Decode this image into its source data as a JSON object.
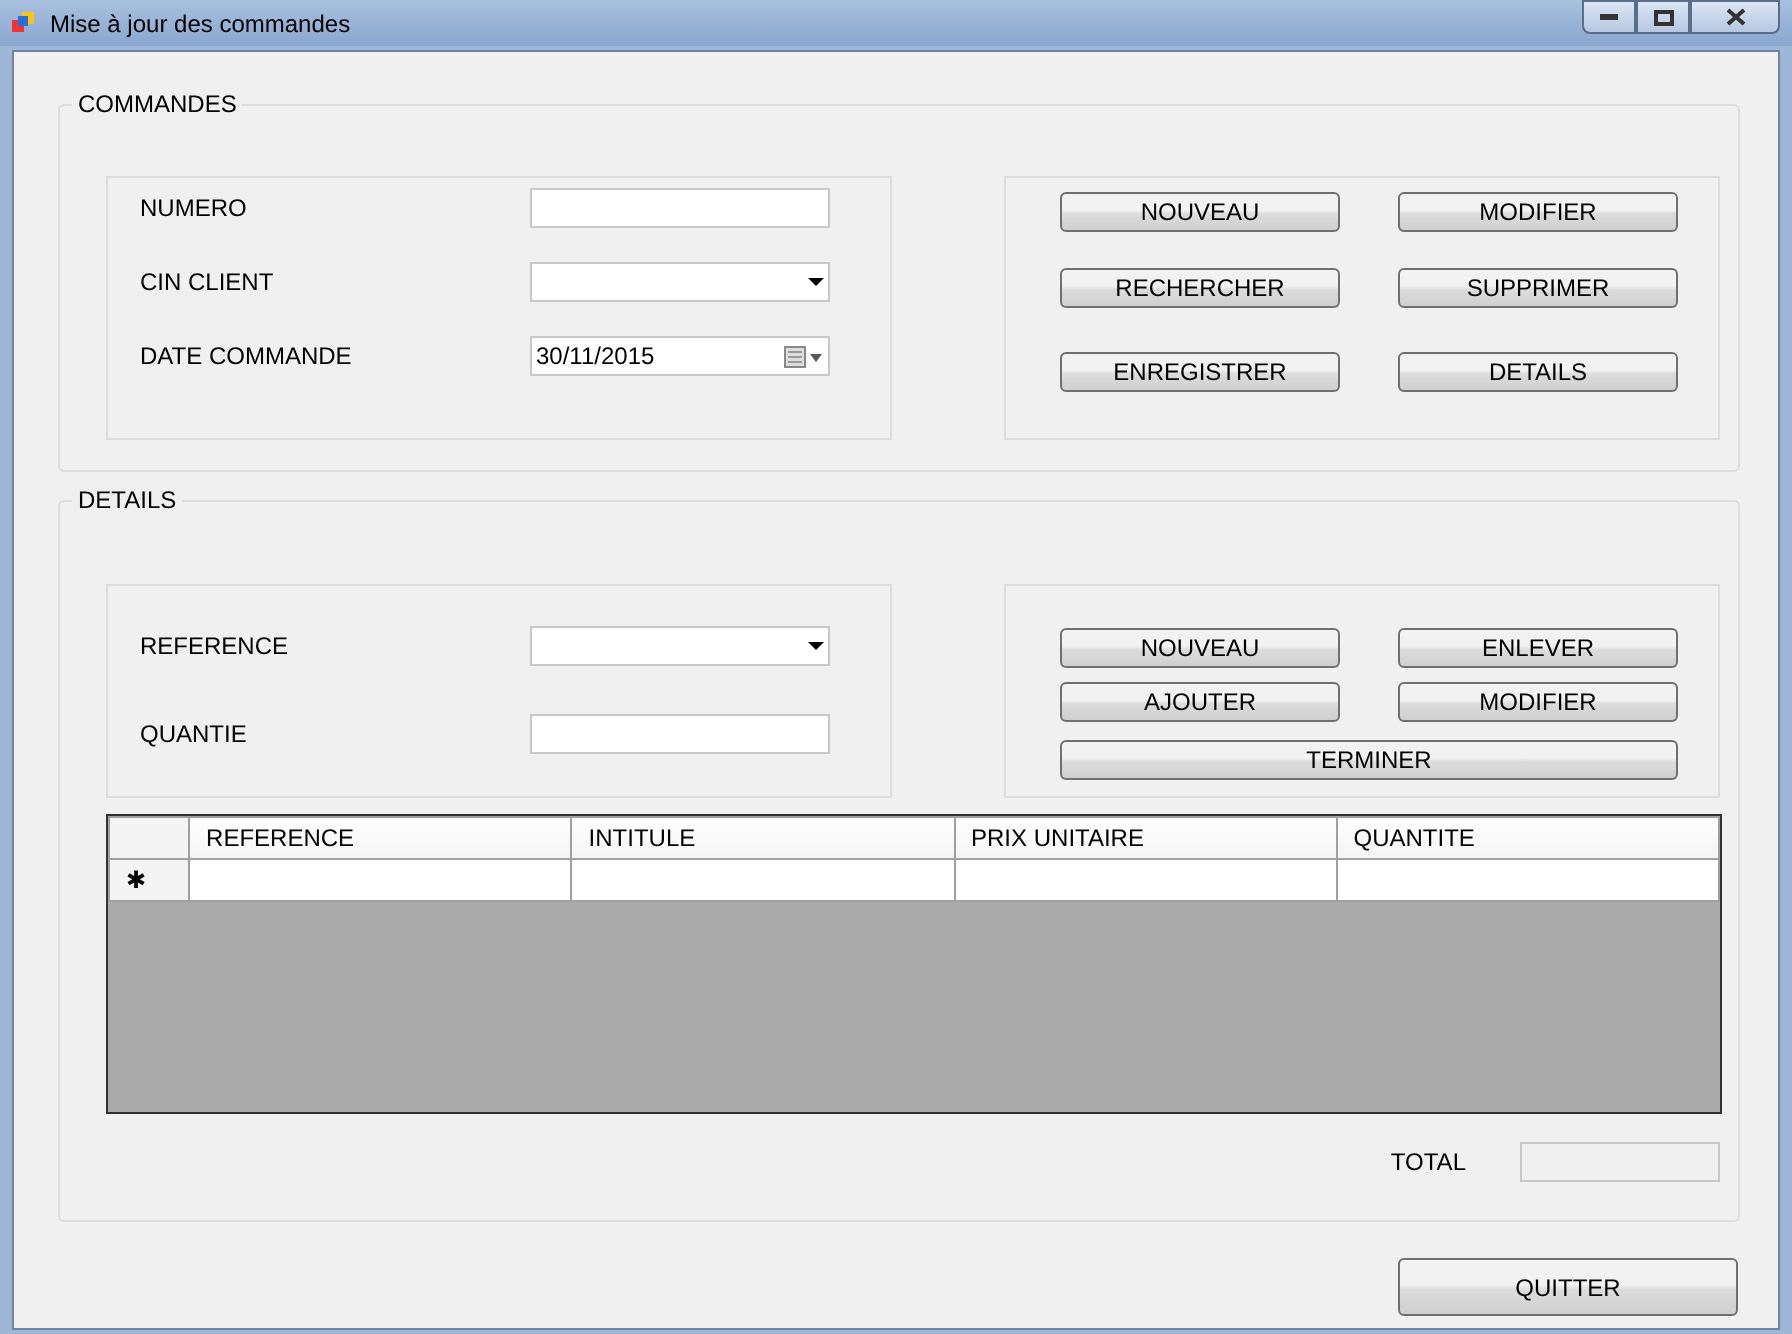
{
  "window": {
    "title": "Mise à jour des commandes"
  },
  "commandes": {
    "title": "COMMANDES",
    "fields": [
      {
        "label": "NUMERO",
        "kind": "text"
      },
      {
        "label": "CIN CLIENT",
        "kind": "combo"
      },
      {
        "label": "DATE COMMANDE",
        "kind": "date",
        "value": "30/11/2015"
      }
    ],
    "buttons": [
      {
        "label": "NOUVEAU"
      },
      {
        "label": "MODIFIER"
      },
      {
        "label": "RECHERCHER"
      },
      {
        "label": "SUPPRIMER"
      },
      {
        "label": "ENREGISTRER"
      },
      {
        "label": "DETAILS"
      }
    ]
  },
  "details": {
    "title": "DETAILS",
    "fields": [
      {
        "label": "REFERENCE",
        "kind": "combo"
      },
      {
        "label": "QUANTIE",
        "kind": "text"
      }
    ],
    "buttons": [
      {
        "label": "NOUVEAU"
      },
      {
        "label": "ENLEVER"
      },
      {
        "label": "AJOUTER"
      },
      {
        "label": "MODIFIER"
      },
      {
        "label": "TERMINER",
        "kind": "wide"
      }
    ],
    "table": {
      "columns": [
        "REFERENCE",
        "INTITULE",
        "PRIX UNITAIRE",
        "QUANTITE"
      ],
      "new_row_marker": "✱"
    },
    "total": {
      "label": "TOTAL",
      "disabled": true
    }
  },
  "quit_button": {
    "label": "QUITTER"
  }
}
